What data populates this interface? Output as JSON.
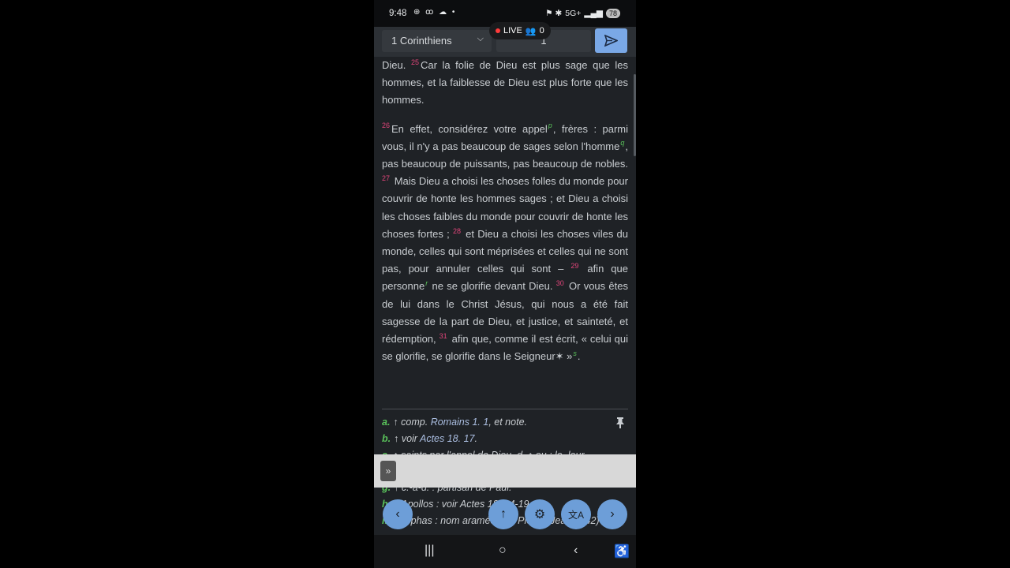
{
  "status": {
    "time": "9:48",
    "left_icons": "⊕ ꝏ ☁ •",
    "network": "5G+",
    "battery": "78"
  },
  "header": {
    "book": "1 Corinthiens",
    "chapter": "1",
    "live_label": "LIVE",
    "viewers": "0"
  },
  "text": {
    "p1": [
      {
        "t": "Dieu. "
      },
      {
        "v": "25"
      },
      {
        "t": "Car la folie de Dieu est plus sage que les hommes, et la faiblesse de Dieu est plus forte que les hommes."
      }
    ],
    "p2": [
      {
        "v": "26"
      },
      {
        "t": "En effet, considérez votre appel"
      },
      {
        "f": "p"
      },
      {
        "t": ", frères : parmi vous, il n'y a pas beaucoup de sages selon l'homme"
      },
      {
        "f": "q"
      },
      {
        "t": ", pas beaucoup de puissants, pas beaucoup de nobles. "
      },
      {
        "v": "27"
      },
      {
        "t": " Mais Dieu a choisi les choses folles du monde pour couvrir de honte les hommes sages ; et Dieu a choisi les choses faibles du monde pour couvrir de honte les choses fortes ; "
      },
      {
        "v": "28"
      },
      {
        "t": " et Dieu a choisi les choses viles du monde, celles qui sont méprisées et celles qui ne sont pas, pour annuler celles qui sont – "
      },
      {
        "v": "29"
      },
      {
        "t": " afin que personne"
      },
      {
        "f": "r"
      },
      {
        "t": " ne se glorifie devant Dieu. "
      },
      {
        "v": "30"
      },
      {
        "t": " Or vous êtes de lui dans le Christ Jésus, qui nous a été fait sagesse de la part de Dieu, et justice, et sainteté, et rédemption, "
      },
      {
        "v": "31"
      },
      {
        "t": " afin que, comme il est écrit, « celui qui se glorifie, se glorifie dans le Seigneur✶ »"
      },
      {
        "f": "s"
      },
      {
        "t": "."
      }
    ]
  },
  "notes": [
    {
      "letter": "a.",
      "pre": "↑ comp. ",
      "ref": "Romains 1. 1",
      "post": ", et note."
    },
    {
      "letter": "b.",
      "pre": "↑ voir ",
      "ref": "Actes 18. 17",
      "post": "."
    },
    {
      "letter": "c.",
      "pre": "↑ saints par l'appel de Dieu. ",
      "ref": "",
      "post": "d. ↑ ou : le, leur"
    }
  ],
  "notes_below": [
    {
      "letter": "g.",
      "text": "↑ c.-à-d. : partisan de Paul."
    },
    {
      "letter": "h.",
      "text": "↑ Apollos : voir Actes 18. 24-19. 1"
    },
    {
      "letter": "i.",
      "text": "↑ Céphas : nom araméen de Pierre (Jean 1. 42)"
    }
  ],
  "nav_buttons": {
    "prev": "‹",
    "up": "↑",
    "settings": "⚙",
    "translate": "文A",
    "next": "›"
  },
  "system_nav": {
    "recents": "|||",
    "home": "○",
    "back": "‹",
    "accessibility": "♿"
  }
}
